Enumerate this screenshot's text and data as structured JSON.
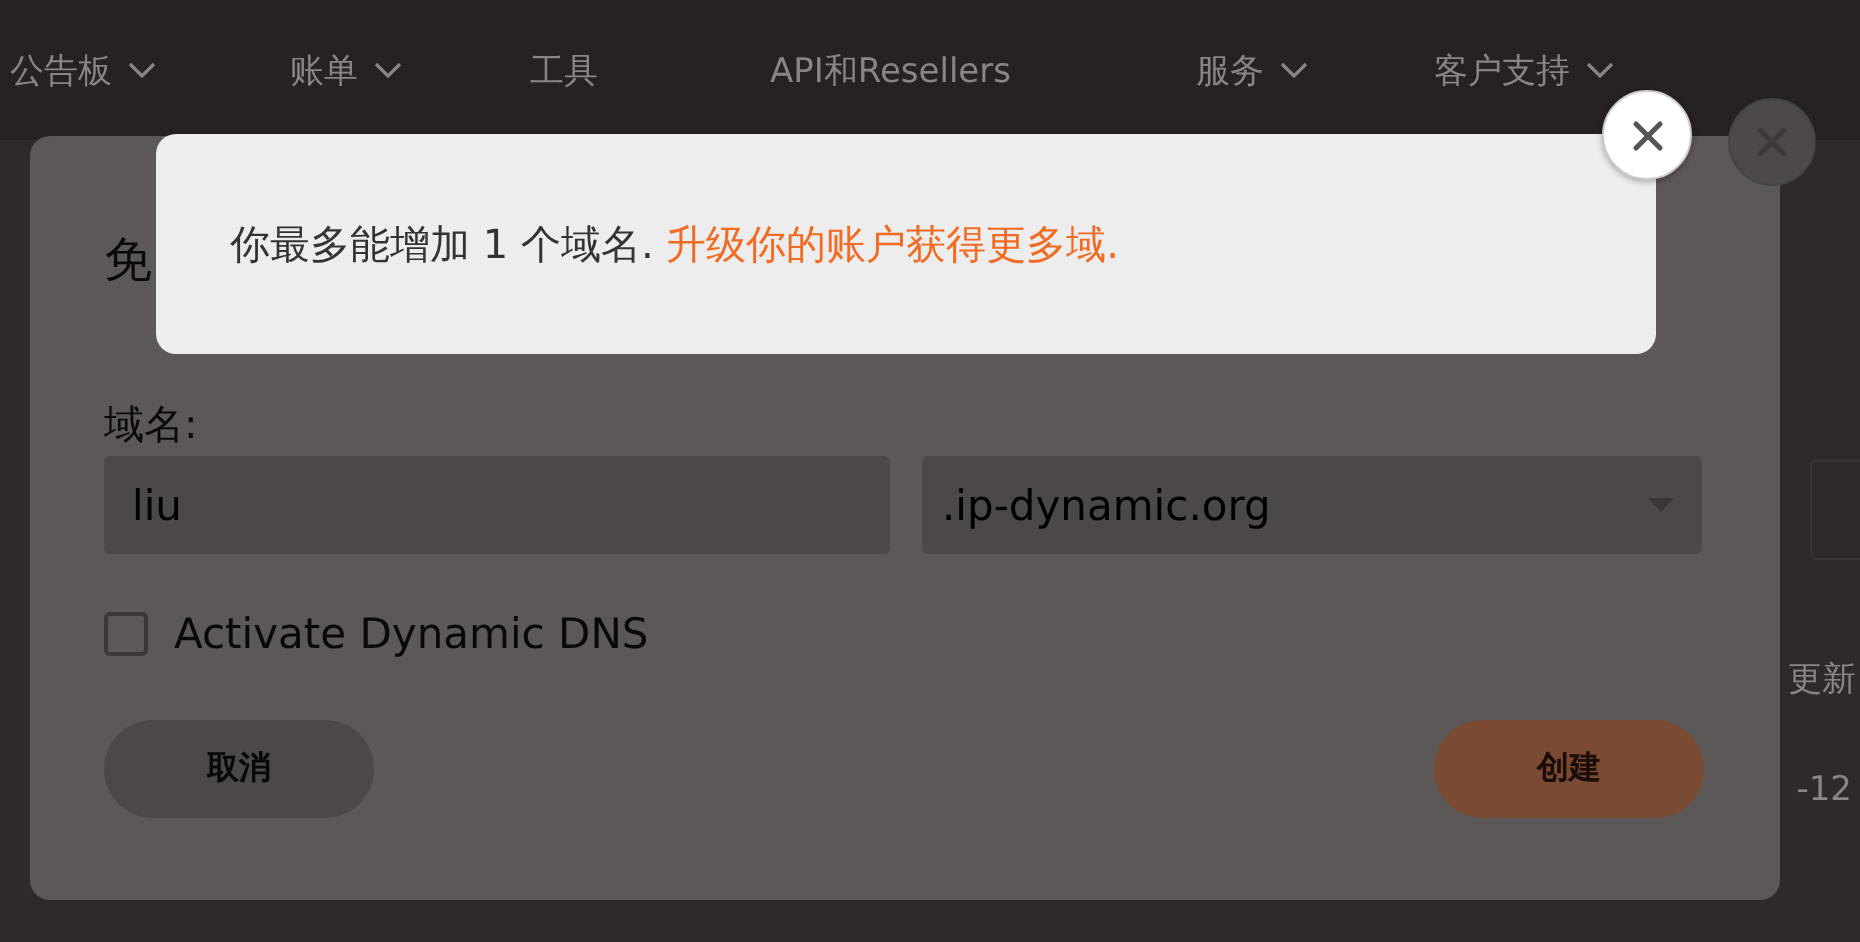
{
  "nav": [
    {
      "label": "公告板",
      "dropdown": true
    },
    {
      "label": "账单",
      "dropdown": true
    },
    {
      "label": "工具",
      "dropdown": false
    },
    {
      "label": "API和Resellers",
      "dropdown": false
    },
    {
      "label": "服务",
      "dropdown": true
    },
    {
      "label": "客户支持",
      "dropdown": true
    }
  ],
  "page_behind": {
    "column_header": "更新",
    "cell": "-12"
  },
  "dialog": {
    "title": "免",
    "domain_label": "域名:",
    "domain_value": "liu",
    "suffix_value": ".ip-dynamic.org",
    "dynamic_dns": {
      "label": "Activate Dynamic DNS",
      "checked": false
    },
    "buttons": [
      {
        "label": "取消",
        "kind": "secondary"
      },
      {
        "label": "创建",
        "kind": "primary"
      }
    ]
  },
  "alert": {
    "text": "你最多能增加 1 个域名. ",
    "link": "升级你的账户获得更多域."
  }
}
